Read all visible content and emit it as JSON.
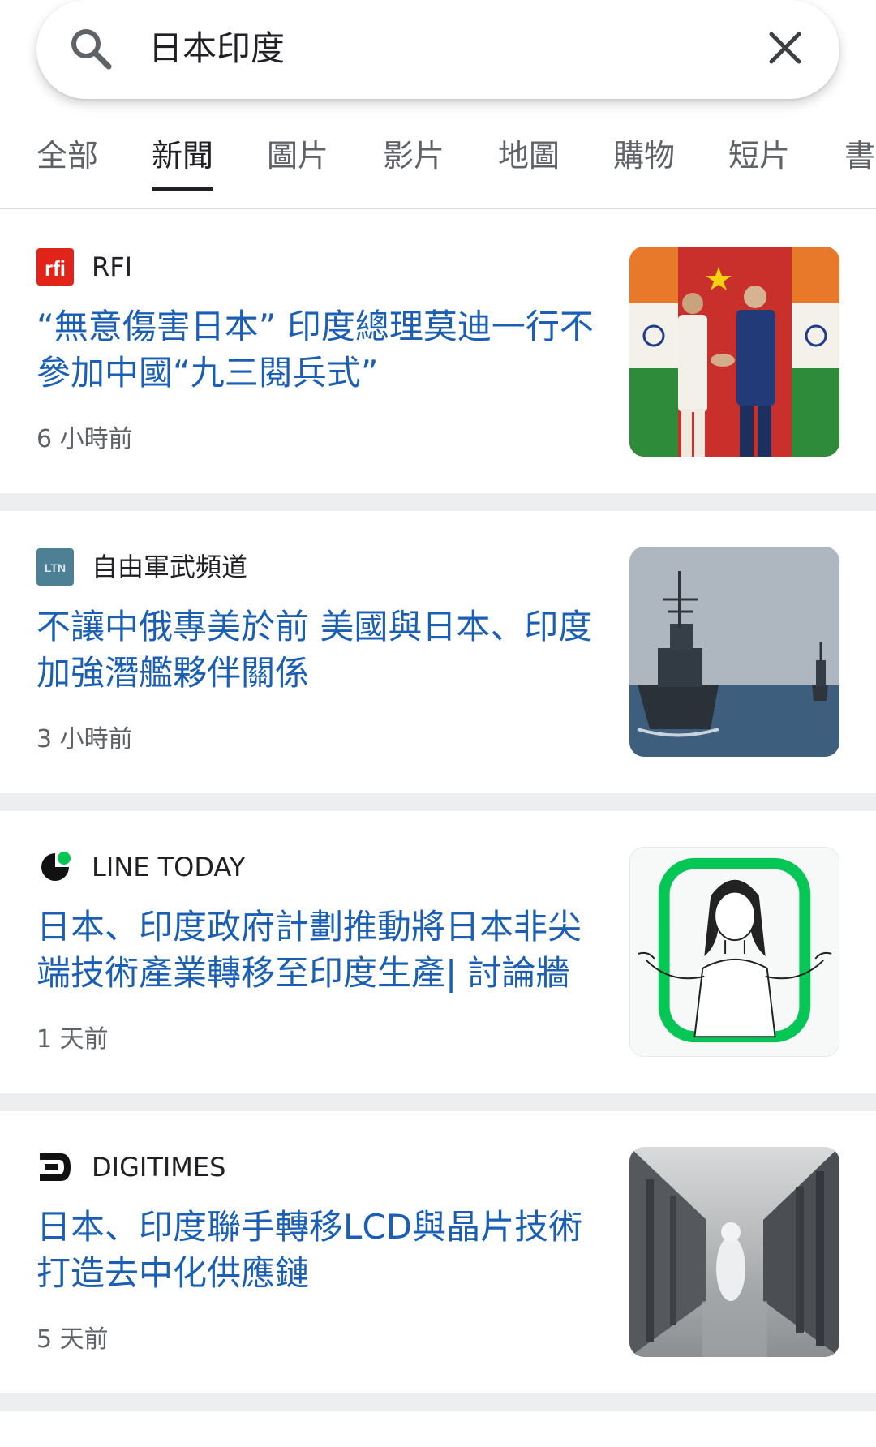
{
  "search": {
    "query": "日本印度"
  },
  "tabs": [
    {
      "label": "全部"
    },
    {
      "label": "新聞"
    },
    {
      "label": "圖片"
    },
    {
      "label": "影片"
    },
    {
      "label": "地圖"
    },
    {
      "label": "購物"
    },
    {
      "label": "短片"
    },
    {
      "label": "書"
    }
  ],
  "active_tab": "新聞",
  "articles": [
    {
      "source": "RFI",
      "logo": "rfi-logo",
      "headline": "“無意傷害日本” 印度總理莫迪一行不參加中國“九三閱兵式”",
      "time": "6 小時前",
      "thumb": "leaders-handshake-flags-photo"
    },
    {
      "source": "自由軍武頻道",
      "logo": "ltn-logo",
      "headline": "不讓中俄專美於前 美國與日本、印度加強潛艦夥伴關係",
      "time": "3 小時前",
      "thumb": "warships-at-sea-photo"
    },
    {
      "source": "LINE TODAY",
      "logo": "line-today-logo",
      "headline": "日本、印度政府計劃推動將日本非尖端技術產業轉移至印度生產| 討論牆",
      "time": "1 天前",
      "thumb": "shrugging-woman-illustration"
    },
    {
      "source": "DIGITIMES",
      "logo": "digitimes-logo",
      "headline": "日本、印度聯手轉移LCD與晶片技術 打造去中化供應鏈",
      "time": "5 天前",
      "thumb": "cleanroom-fab-photo"
    }
  ],
  "colors": {
    "link": "#1a5fb4",
    "muted": "#5f6368",
    "separator": "#eceef0",
    "rfi_red": "#e2231a",
    "line_green": "#06c755"
  }
}
